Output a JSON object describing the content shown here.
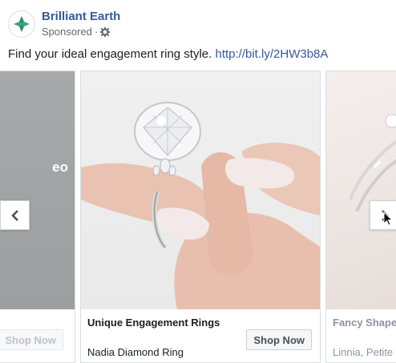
{
  "post": {
    "page_name": "Brilliant Earth",
    "sponsored_label": "Sponsored",
    "separator": "·",
    "caption_text": "Find your ideal engagement ring style.",
    "caption_link": "http://bit.ly/2HW3b8A"
  },
  "carousel": {
    "left_card": {
      "partial_text": "eo",
      "button_label": "Shop Now"
    },
    "main_card": {
      "title": "Unique Engagement Rings",
      "subtitle": "Nadia Diamond Ring",
      "button_label": "Shop Now"
    },
    "right_card": {
      "title": "Fancy Shape E",
      "subtitle": "Linnia, Petite C"
    }
  },
  "icons": {
    "avatar": "brilliant-earth-logo",
    "privacy": "gear-icon",
    "prev": "chevron-left-icon",
    "next": "chevron-right-icon",
    "cursor": "mouse-pointer-icon"
  },
  "colors": {
    "link": "#385898",
    "brand_green": "#2e8b6a",
    "text": "#1c1e21",
    "muted": "#606770"
  }
}
